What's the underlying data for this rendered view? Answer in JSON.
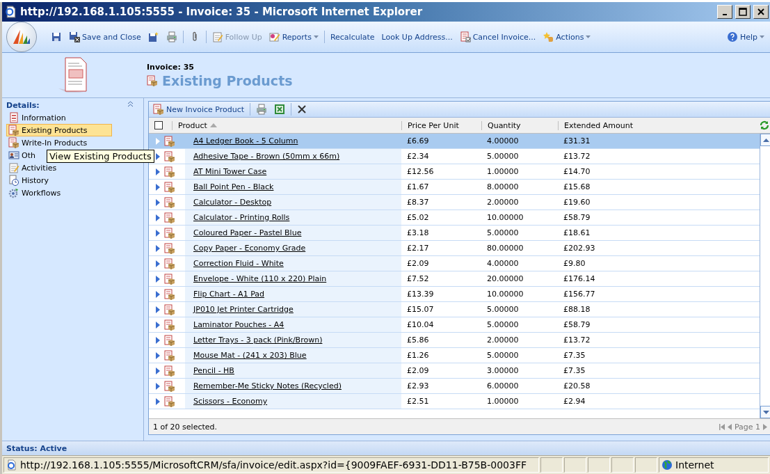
{
  "window": {
    "title": "http://192.168.1.105:5555 - Invoice: 35 - Microsoft Internet Explorer"
  },
  "toolbar": {
    "items": [
      {
        "kind": "icon"
      },
      {
        "kind": "button",
        "label": "Save and Close",
        "disabled": false
      },
      {
        "kind": "icon"
      },
      {
        "kind": "icon"
      },
      {
        "kind": "separator"
      },
      {
        "kind": "icon"
      },
      {
        "kind": "separator"
      },
      {
        "kind": "button",
        "label": "Follow Up",
        "disabled": true
      },
      {
        "kind": "menu",
        "label": "Reports"
      },
      {
        "kind": "separator"
      },
      {
        "kind": "button",
        "label": "Recalculate",
        "disabled": false
      },
      {
        "kind": "button",
        "label": "Look Up Address...",
        "disabled": false
      },
      {
        "kind": "button",
        "label": "Cancel Invoice...",
        "disabled": false
      },
      {
        "kind": "menu",
        "label": "Actions"
      }
    ],
    "help": "Help"
  },
  "header": {
    "record": "Invoice: 35",
    "title": "Existing Products"
  },
  "sidebar": {
    "heading": "Details:",
    "items": [
      {
        "label": "Information",
        "selected": false
      },
      {
        "label": "Existing Products",
        "selected": true
      },
      {
        "label": "Write-In Products",
        "selected": false
      },
      {
        "label": "Oth",
        "selected": false
      },
      {
        "label": "Activities",
        "selected": false
      },
      {
        "label": "History",
        "selected": false
      },
      {
        "label": "Workflows",
        "selected": false
      }
    ],
    "tooltip": "View Existing Products"
  },
  "grid_toolbar": {
    "new_label": "New Invoice Product"
  },
  "table": {
    "select_all_checked": false,
    "columns": [
      "Product",
      "Price Per Unit",
      "Quantity",
      "Extended Amount"
    ],
    "rows": [
      {
        "product": "A4 Ledger Book - 5 Column",
        "price": "£6.69",
        "quantity": "4.00000",
        "amount": "£31.31",
        "selected": true
      },
      {
        "product": "Adhesive Tape - Brown (50mm x 66m)",
        "price": "£2.34",
        "quantity": "5.00000",
        "amount": "£13.72",
        "selected": false
      },
      {
        "product": "AT Mini Tower Case",
        "price": "£12.56",
        "quantity": "1.00000",
        "amount": "£14.70",
        "selected": false
      },
      {
        "product": "Ball Point Pen - Black",
        "price": "£1.67",
        "quantity": "8.00000",
        "amount": "£15.68",
        "selected": false
      },
      {
        "product": "Calculator - Desktop",
        "price": "£8.37",
        "quantity": "2.00000",
        "amount": "£19.60",
        "selected": false
      },
      {
        "product": "Calculator - Printing Rolls",
        "price": "£5.02",
        "quantity": "10.00000",
        "amount": "£58.79",
        "selected": false
      },
      {
        "product": "Coloured Paper - Pastel Blue",
        "price": "£3.18",
        "quantity": "5.00000",
        "amount": "£18.61",
        "selected": false
      },
      {
        "product": "Copy Paper - Economy Grade",
        "price": "£2.17",
        "quantity": "80.00000",
        "amount": "£202.93",
        "selected": false
      },
      {
        "product": "Correction Fluid - White",
        "price": "£2.09",
        "quantity": "4.00000",
        "amount": "£9.80",
        "selected": false
      },
      {
        "product": "Envelope - White (110 x 220) Plain",
        "price": "£7.52",
        "quantity": "20.00000",
        "amount": "£176.14",
        "selected": false
      },
      {
        "product": "Flip Chart - A1 Pad",
        "price": "£13.39",
        "quantity": "10.00000",
        "amount": "£156.77",
        "selected": false
      },
      {
        "product": "JP010 Jet Printer Cartridge",
        "price": "£15.07",
        "quantity": "5.00000",
        "amount": "£88.18",
        "selected": false
      },
      {
        "product": "Laminator Pouches - A4",
        "price": "£10.04",
        "quantity": "5.00000",
        "amount": "£58.79",
        "selected": false
      },
      {
        "product": "Letter Trays - 3 pack (Pink/Brown)",
        "price": "£5.86",
        "quantity": "2.00000",
        "amount": "£13.72",
        "selected": false
      },
      {
        "product": "Mouse Mat - (241 x 203) Blue",
        "price": "£1.26",
        "quantity": "5.00000",
        "amount": "£7.35",
        "selected": false
      },
      {
        "product": "Pencil - HB",
        "price": "£2.09",
        "quantity": "3.00000",
        "amount": "£7.35",
        "selected": false
      },
      {
        "product": "Remember-Me Sticky Notes (Recycled)",
        "price": "£2.93",
        "quantity": "6.00000",
        "amount": "£20.58",
        "selected": false
      },
      {
        "product": "Scissors - Economy",
        "price": "£2.51",
        "quantity": "1.00000",
        "amount": "£2.94",
        "selected": false
      }
    ],
    "footer": "1 of 20 selected.",
    "page": "Page 1"
  },
  "form_status": "Status: Active",
  "status_bar": {
    "url": "http://192.168.1.105:5555/MicrosoftCRM/sfa/invoice/edit.aspx?id={9009FAEF-6931-DD11-B75B-0003FF",
    "zone": "Internet"
  }
}
